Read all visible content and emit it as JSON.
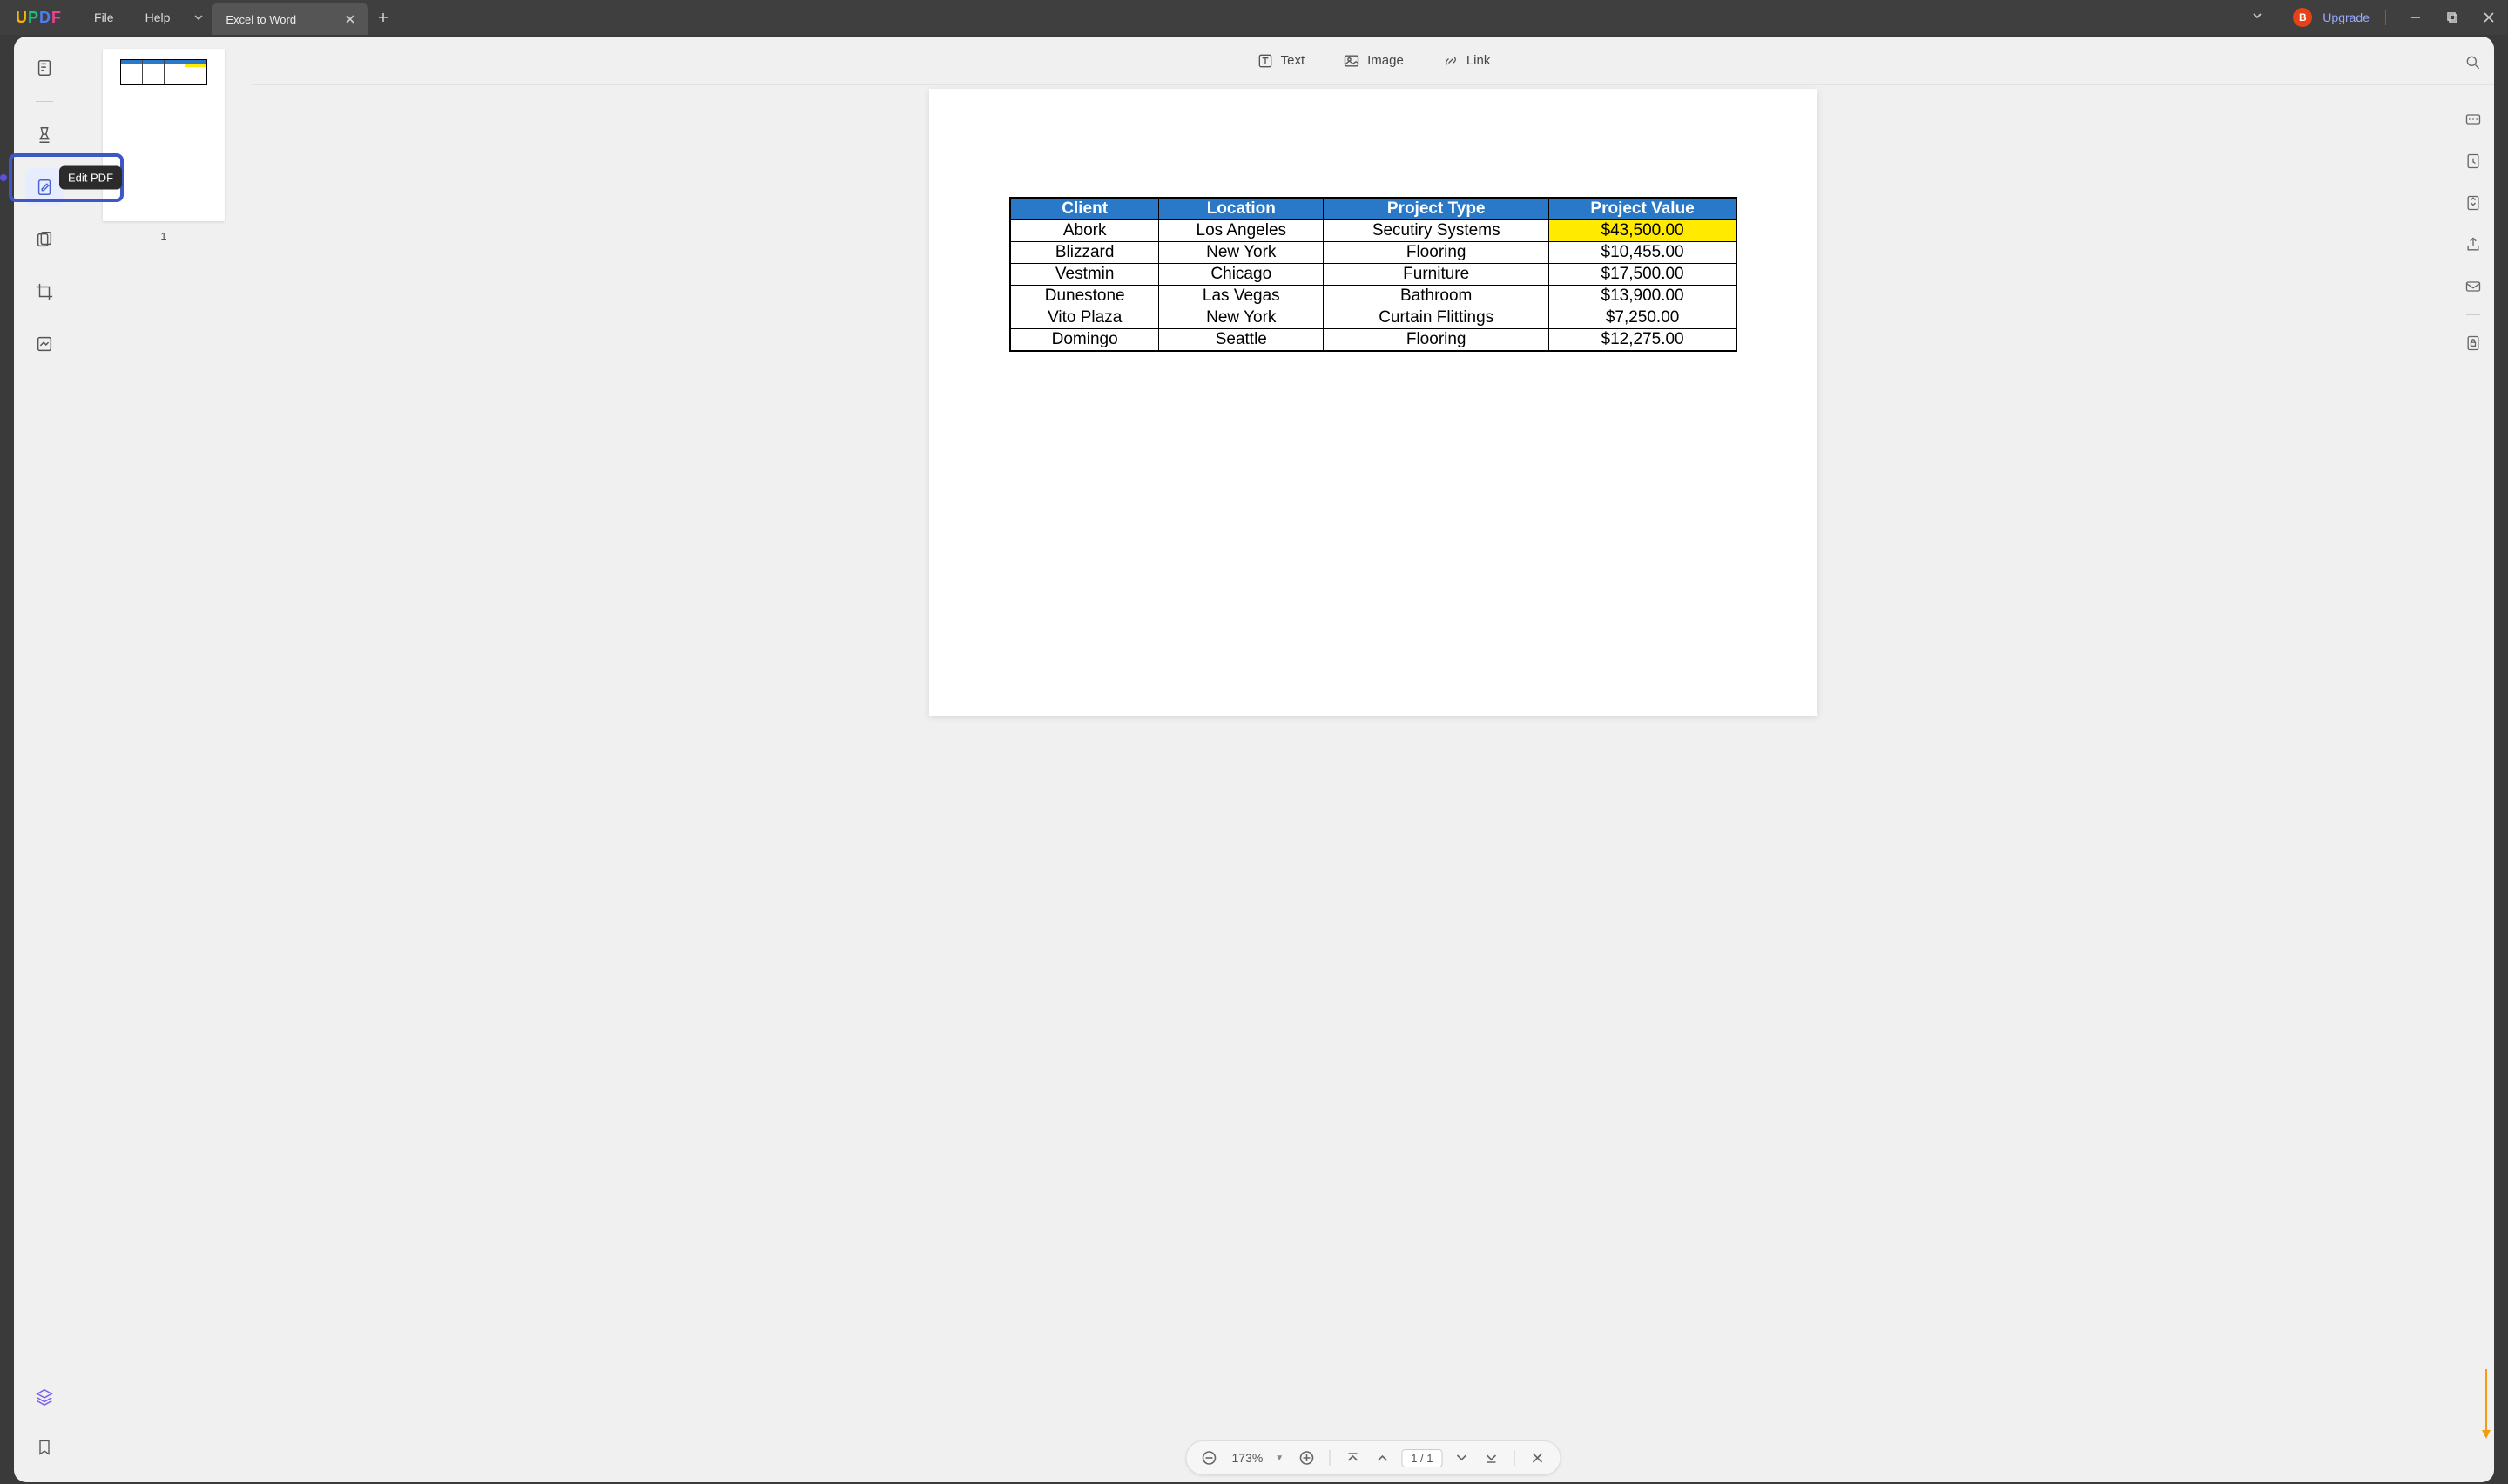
{
  "brand": "UPDF",
  "menu": {
    "file": "File",
    "help": "Help"
  },
  "tab": {
    "title": "Excel to Word"
  },
  "upgrade": {
    "avatar_letter": "B",
    "label": "Upgrade"
  },
  "tooltip": {
    "edit_pdf": "Edit PDF"
  },
  "edit_toolbar": {
    "text": "Text",
    "image": "Image",
    "link": "Link"
  },
  "thumbnail": {
    "page_number": "1"
  },
  "table": {
    "headers": [
      "Client",
      "Location",
      "Project Type",
      "Project Value"
    ],
    "rows": [
      {
        "c0": "Abork",
        "c1": "Los Angeles",
        "c2": "Secutiry Systems",
        "c3": "$43,500.00",
        "highlight_last": true
      },
      {
        "c0": "Blizzard",
        "c1": "New York",
        "c2": "Flooring",
        "c3": "$10,455.00",
        "highlight_last": false
      },
      {
        "c0": "Vestmin",
        "c1": "Chicago",
        "c2": "Furniture",
        "c3": "$17,500.00",
        "highlight_last": false
      },
      {
        "c0": "Dunestone",
        "c1": "Las Vegas",
        "c2": "Bathroom",
        "c3": "$13,900.00",
        "highlight_last": false
      },
      {
        "c0": "Vito Plaza",
        "c1": "New York",
        "c2": "Curtain Flittings",
        "c3": "$7,250.00",
        "highlight_last": false
      },
      {
        "c0": "Domingo",
        "c1": "Seattle",
        "c2": "Flooring",
        "c3": "$12,275.00",
        "highlight_last": false
      }
    ]
  },
  "bottom": {
    "zoom": "173%",
    "page_indicator": "1 / 1"
  },
  "chart_data": {
    "type": "table",
    "title": "",
    "headers": [
      "Client",
      "Location",
      "Project Type",
      "Project Value"
    ],
    "rows": [
      [
        "Abork",
        "Los Angeles",
        "Secutiry Systems",
        43500.0
      ],
      [
        "Blizzard",
        "New York",
        "Flooring",
        10455.0
      ],
      [
        "Vestmin",
        "Chicago",
        "Furniture",
        17500.0
      ],
      [
        "Dunestone",
        "Las Vegas",
        "Bathroom",
        13900.0
      ],
      [
        "Vito Plaza",
        "New York",
        "Curtain Flittings",
        7250.0
      ],
      [
        "Domingo",
        "Seattle",
        "Flooring",
        12275.0
      ]
    ],
    "highlight": {
      "row": 0,
      "col": 3,
      "color": "#ffea00"
    }
  }
}
